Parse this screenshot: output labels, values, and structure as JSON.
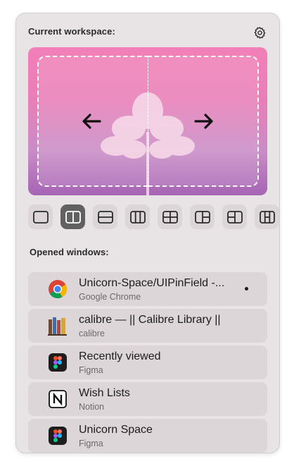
{
  "header": {
    "current_workspace_label": "Current workspace:",
    "settings_icon": "gear-icon"
  },
  "preview": {
    "left_arrow_icon": "arrow-left-icon",
    "right_arrow_icon": "arrow-right-icon"
  },
  "layouts": [
    {
      "name": "full",
      "icon": "layout-full-icon",
      "active": false
    },
    {
      "name": "two-columns",
      "icon": "layout-two-columns-icon",
      "active": true
    },
    {
      "name": "two-rows",
      "icon": "layout-two-rows-icon",
      "active": false
    },
    {
      "name": "three-columns",
      "icon": "layout-three-columns-icon",
      "active": false
    },
    {
      "name": "four-grid",
      "icon": "layout-four-grid-icon",
      "active": false
    },
    {
      "name": "left-main-right-split",
      "icon": "layout-left-main-right-split-icon",
      "active": false
    },
    {
      "name": "left-split-right-main",
      "icon": "layout-left-split-right-main-icon",
      "active": false
    },
    {
      "name": "columns-with-rows",
      "icon": "layout-columns-with-rows-icon",
      "active": false
    }
  ],
  "windows_section": {
    "label": "Opened windows:"
  },
  "windows": [
    {
      "title": "Unicorn-Space/UIPinField -...",
      "app": "Google Chrome",
      "icon": "chrome-icon",
      "active": true
    },
    {
      "title": "calibre — || Calibre Library ||",
      "app": "calibre",
      "icon": "calibre-icon",
      "active": false
    },
    {
      "title": "Recently viewed",
      "app": "Figma",
      "icon": "figma-icon",
      "active": false
    },
    {
      "title": "Wish Lists",
      "app": "Notion",
      "icon": "notion-icon",
      "active": false
    },
    {
      "title": "Unicorn Space",
      "app": "Figma",
      "icon": "figma-icon",
      "active": false
    }
  ],
  "colors": {
    "panel_bg": "#e8e3e4",
    "item_bg": "#dcd6d8",
    "active_layout_bg": "#616161",
    "preview_gradient_top": "#f27fb8",
    "preview_gradient_bottom": "#a664b4"
  }
}
